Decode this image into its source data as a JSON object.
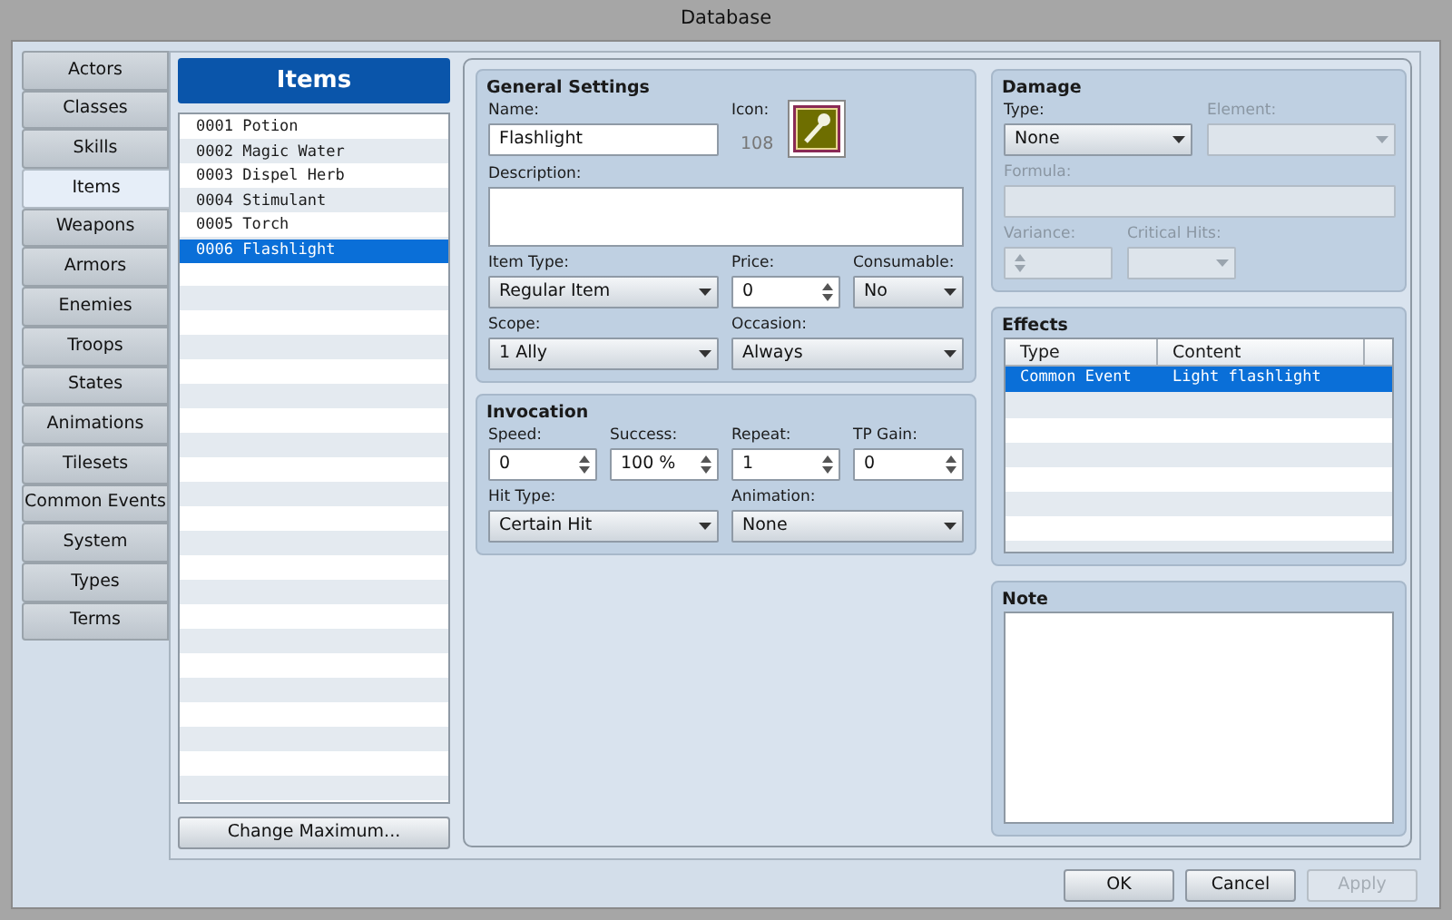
{
  "window": {
    "title": "Database"
  },
  "categories": [
    {
      "label": "Actors",
      "selected": false
    },
    {
      "label": "Classes",
      "selected": false
    },
    {
      "label": "Skills",
      "selected": false
    },
    {
      "label": "Items",
      "selected": true
    },
    {
      "label": "Weapons",
      "selected": false
    },
    {
      "label": "Armors",
      "selected": false
    },
    {
      "label": "Enemies",
      "selected": false
    },
    {
      "label": "Troops",
      "selected": false
    },
    {
      "label": "States",
      "selected": false
    },
    {
      "label": "Animations",
      "selected": false
    },
    {
      "label": "Tilesets",
      "selected": false
    },
    {
      "label": "Common Events",
      "selected": false
    },
    {
      "label": "System",
      "selected": false
    },
    {
      "label": "Types",
      "selected": false
    },
    {
      "label": "Terms",
      "selected": false
    }
  ],
  "item_list": {
    "title": "Items",
    "items": [
      {
        "label": "0001 Potion",
        "selected": false
      },
      {
        "label": "0002 Magic Water",
        "selected": false
      },
      {
        "label": "0003 Dispel Herb",
        "selected": false
      },
      {
        "label": "0004 Stimulant",
        "selected": false
      },
      {
        "label": "0005 Torch",
        "selected": false
      },
      {
        "label": "0006 Flashlight",
        "selected": true
      }
    ],
    "button": "Change Maximum..."
  },
  "general_settings": {
    "title": "General Settings",
    "fields": [
      {
        "label": "Name:",
        "kind": "text",
        "value": "Flashlight",
        "disabled": false
      },
      {
        "label": "Icon:",
        "kind": "icon",
        "value": "108"
      },
      {
        "label": "Description:",
        "kind": "textarea",
        "disabled": false
      },
      {
        "label": "Item Type:",
        "kind": "dropdown",
        "value": "Regular Item",
        "disabled": false
      },
      {
        "label": "Price:",
        "kind": "spinner",
        "value": "0",
        "disabled": false
      },
      {
        "label": "Consumable:",
        "kind": "dropdown",
        "value": "No",
        "disabled": false
      },
      {
        "label": "Scope:",
        "kind": "dropdown",
        "value": "1 Ally",
        "disabled": false
      },
      {
        "label": "Occasion:",
        "kind": "dropdown",
        "value": "Always",
        "disabled": false
      }
    ]
  },
  "invocation": {
    "title": "Invocation",
    "fields": [
      {
        "label": "Speed:",
        "kind": "spinner",
        "value": "0",
        "disabled": false
      },
      {
        "label": "Success:",
        "kind": "spinner",
        "value": "100 %",
        "disabled": false
      },
      {
        "label": "Repeat:",
        "kind": "spinner",
        "value": "1",
        "disabled": false
      },
      {
        "label": "TP Gain:",
        "kind": "spinner",
        "value": "0",
        "disabled": false
      },
      {
        "label": "Hit Type:",
        "kind": "dropdown",
        "value": "Certain Hit",
        "disabled": false
      },
      {
        "label": "Animation:",
        "kind": "dropdown",
        "value": "None",
        "disabled": false
      }
    ]
  },
  "damage": {
    "title": "Damage",
    "fields": [
      {
        "label": "Type:",
        "kind": "dropdown",
        "value": "None",
        "disabled": false
      },
      {
        "label": "Element:",
        "kind": "dropdown",
        "disabled": true
      },
      {
        "label": "Formula:",
        "kind": "text",
        "disabled": true
      },
      {
        "label": "Variance:",
        "kind": "spinner",
        "disabled": true
      },
      {
        "label": "Critical Hits:",
        "kind": "dropdown",
        "disabled": true
      }
    ]
  },
  "effects": {
    "title": "Effects",
    "columns": [
      "Type",
      "Content"
    ],
    "rows": [
      {
        "cells": [
          "Common Event",
          "Light flashlight"
        ],
        "selected": true
      }
    ]
  },
  "note": {
    "title": "Note"
  },
  "buttons": [
    {
      "label": "OK",
      "disabled": false
    },
    {
      "label": "Cancel",
      "disabled": false
    },
    {
      "label": "Apply",
      "disabled": true
    }
  ]
}
